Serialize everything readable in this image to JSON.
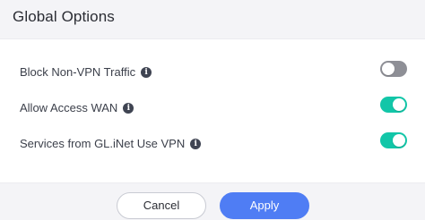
{
  "dialog": {
    "title": "Global Options"
  },
  "options": [
    {
      "label": "Block Non-VPN Traffic",
      "info_icon": "info-icon",
      "enabled": false
    },
    {
      "label": "Allow Access WAN",
      "info_icon": "info-icon",
      "enabled": true
    },
    {
      "label": "Services from GL.iNet Use VPN",
      "info_icon": "info-icon",
      "enabled": true
    }
  ],
  "footer": {
    "cancel_label": "Cancel",
    "apply_label": "Apply"
  },
  "colors": {
    "toggle_on": "#12c6a8",
    "toggle_off": "#8e8f96",
    "primary": "#4f7df4"
  }
}
